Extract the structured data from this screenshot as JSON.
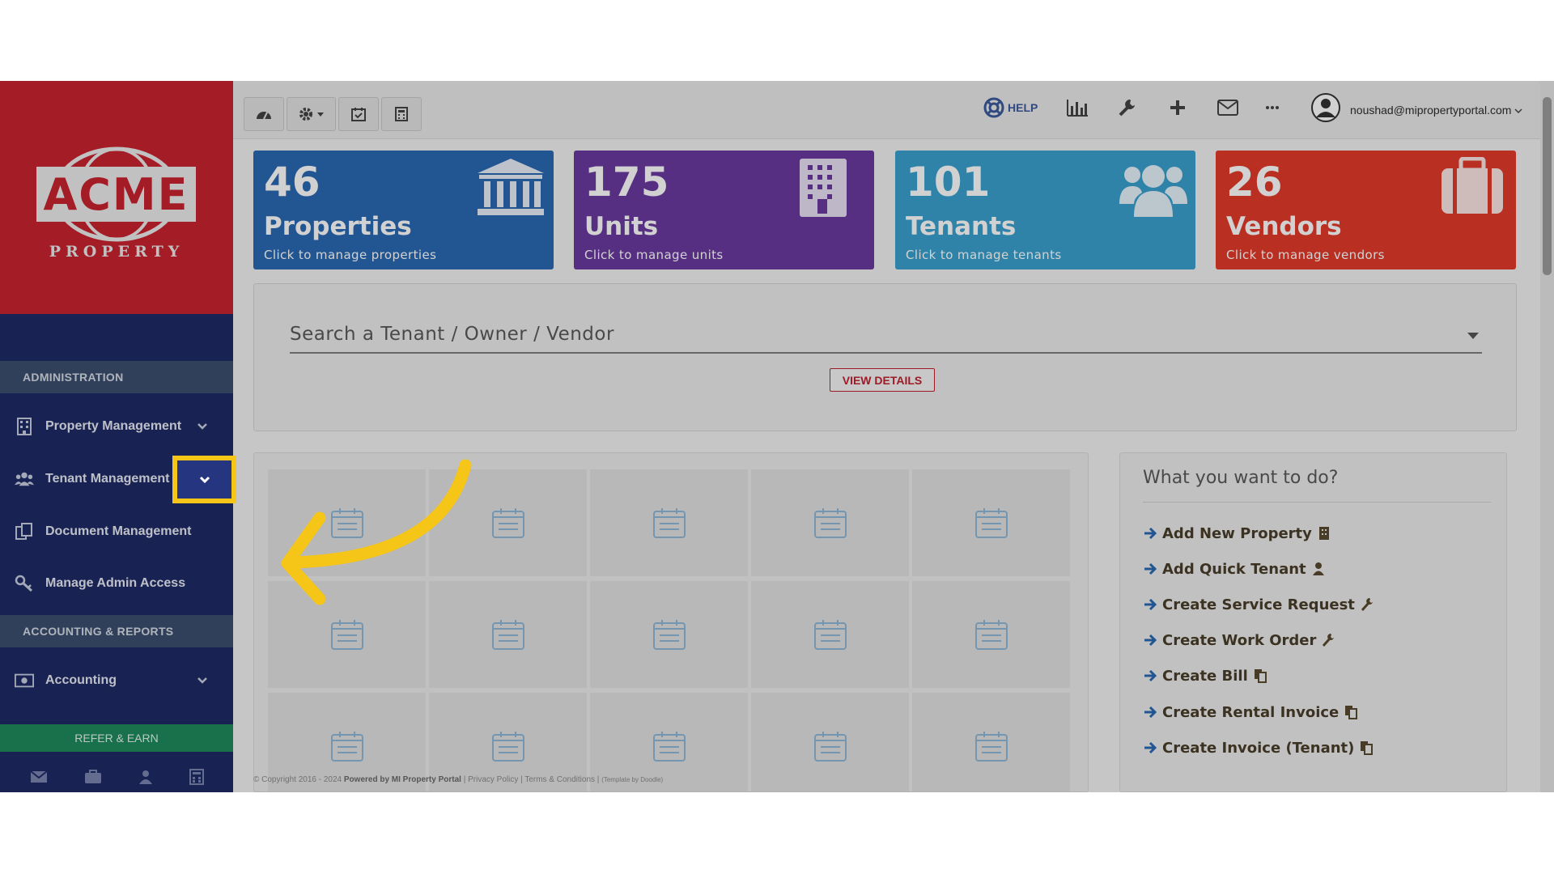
{
  "brand": {
    "logo_text": "ACME",
    "logo_sub": "PROPERTY"
  },
  "sidebar": {
    "sections": [
      {
        "title": "ADMINISTRATION"
      },
      {
        "title": "ACCOUNTING & REPORTS"
      }
    ],
    "items": [
      {
        "label": "Property Management",
        "icon": "building-icon"
      },
      {
        "label": "Tenant Management",
        "icon": "users-icon"
      },
      {
        "label": "Document Management",
        "icon": "documents-icon"
      },
      {
        "label": "Manage Admin Access",
        "icon": "key-icon"
      },
      {
        "label": "Accounting",
        "icon": "money-icon"
      }
    ],
    "refer_label": "REFER & EARN",
    "bottom_icons": [
      "envelope-icon",
      "briefcase-icon",
      "user-icon",
      "calculator-icon"
    ]
  },
  "topbar": {
    "left_buttons": [
      "dashboard-icon",
      "settings-icon",
      "calendar-check-icon",
      "calculator-icon"
    ],
    "help_label": "HELP",
    "user_email": "noushad@mipropertyportal.com"
  },
  "cards": [
    {
      "count": "46",
      "title": "Properties",
      "subtitle": "Click to manage properties",
      "color": "#2a6ab3",
      "icon": "bank-icon"
    },
    {
      "count": "175",
      "title": "Units",
      "subtitle": "Click to manage units",
      "color": "#6a3aa0",
      "icon": "building-icon"
    },
    {
      "count": "101",
      "title": "Tenants",
      "subtitle": "Click to manage tenants",
      "color": "#3aa0cf",
      "icon": "users-icon"
    },
    {
      "count": "26",
      "title": "Vendors",
      "subtitle": "Click to manage vendors",
      "color": "#e23a2a",
      "icon": "briefcase-icon"
    }
  ],
  "search": {
    "placeholder": "Search a Tenant / Owner / Vendor",
    "button_label": "VIEW DETAILS"
  },
  "actions": {
    "title": "What you want to do?",
    "items": [
      {
        "label": "Add New Property",
        "icon": "building-icon"
      },
      {
        "label": "Add Quick Tenant",
        "icon": "user-icon"
      },
      {
        "label": "Create Service Request",
        "icon": "wrench-icon"
      },
      {
        "label": "Create Work Order",
        "icon": "wrench-icon"
      },
      {
        "label": "Create Bill",
        "icon": "copy-icon"
      },
      {
        "label": "Create Rental Invoice",
        "icon": "copy-icon"
      },
      {
        "label": "Create Invoice (Tenant)",
        "icon": "copy-icon"
      }
    ]
  },
  "footer": {
    "copyright": "© Copyright 2016 - 2024",
    "powered": "Powered by MI Property Portal",
    "privacy": "Privacy Policy",
    "terms": "Terms & Conditions",
    "template": "(Template by Doodle)"
  },
  "colors": {
    "accent_yellow": "#f5c518",
    "sidebar_bg": "#1e2a66",
    "logo_bg": "#c8232e"
  }
}
